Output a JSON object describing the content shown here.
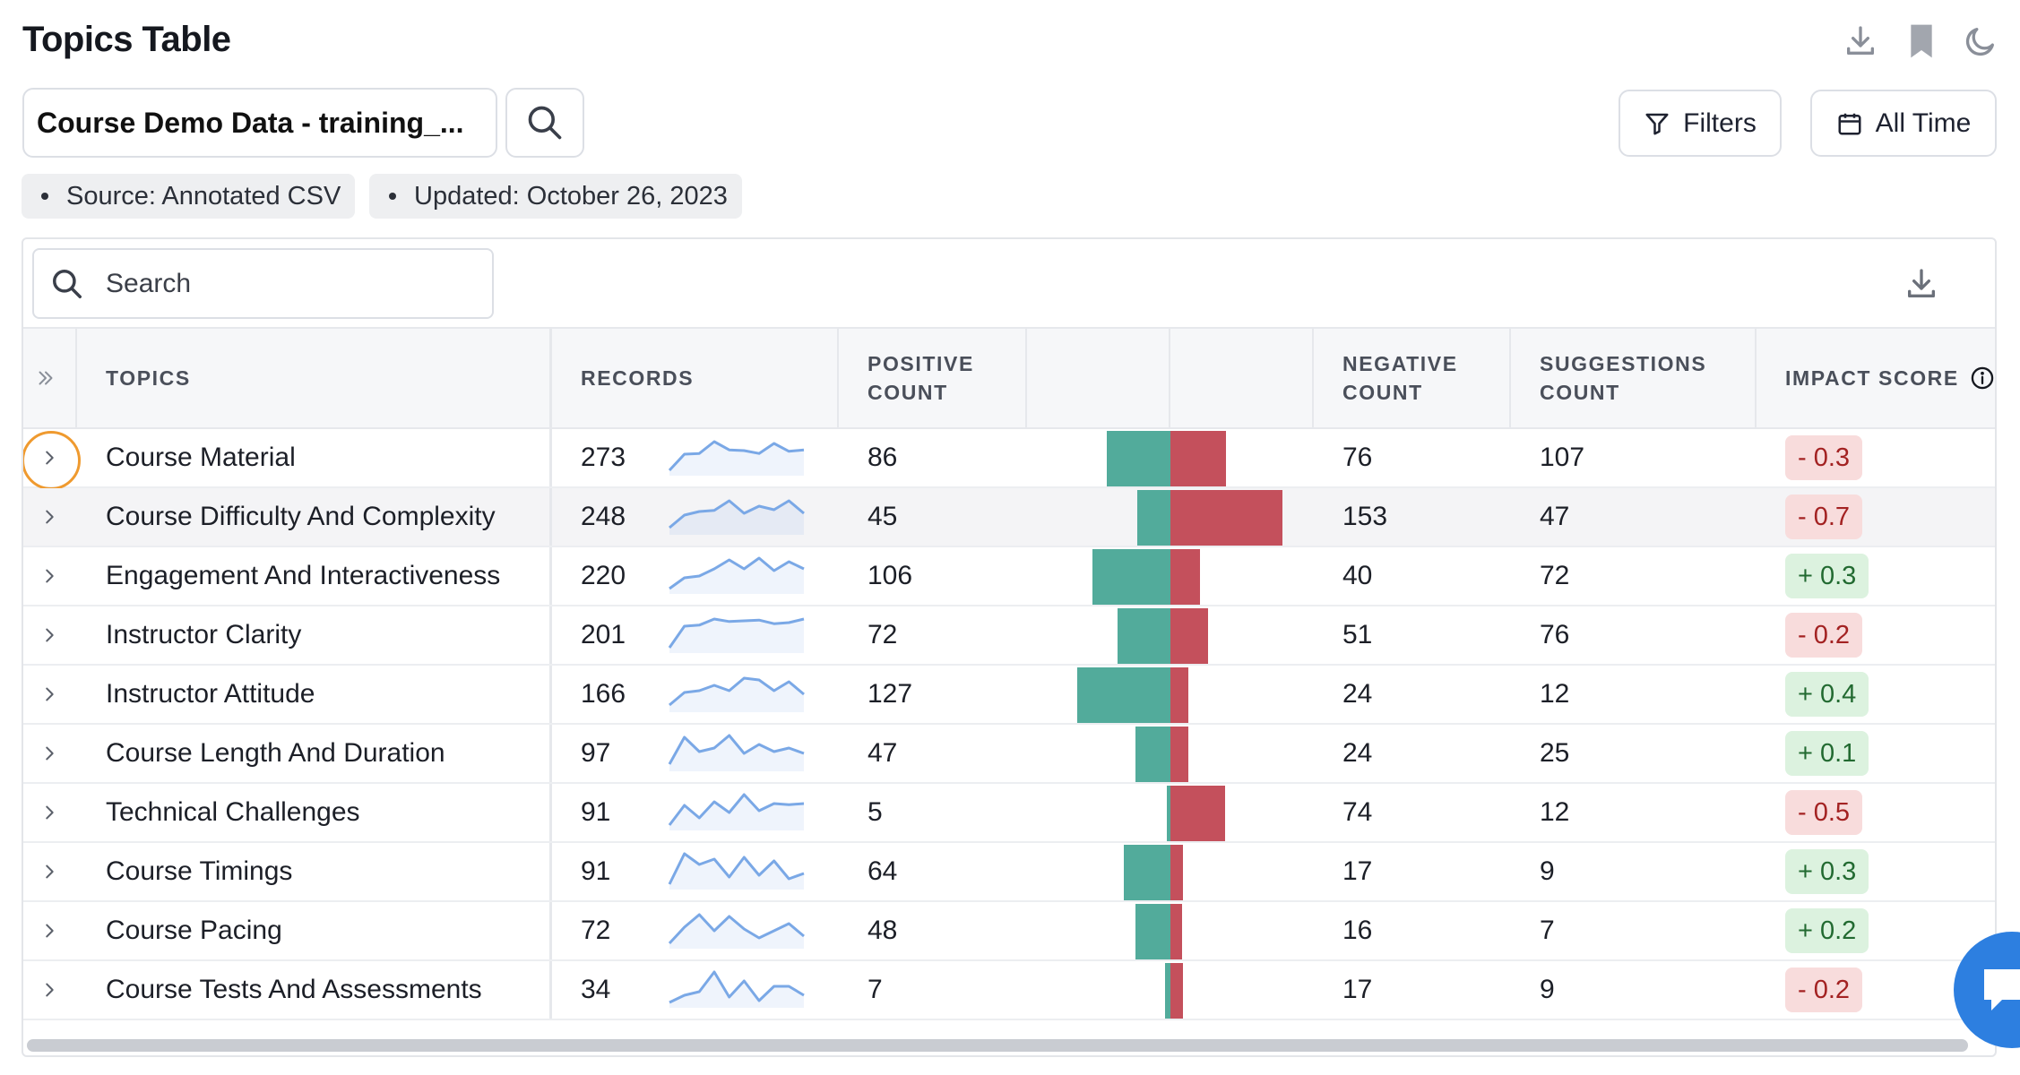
{
  "header": {
    "title": "Topics Table",
    "icons": [
      "download-icon",
      "bookmark-icon",
      "moon-icon"
    ]
  },
  "dataset": {
    "name": "Course Demo Data - training_...",
    "search_icon": "search-icon"
  },
  "actions": {
    "filters_label": "Filters",
    "date_label": "All Time"
  },
  "chips": {
    "source": "Source: Annotated CSV",
    "updated": "Updated: October 26, 2023"
  },
  "table": {
    "search_placeholder": "Search",
    "columns": {
      "topics": "TOPICS",
      "records": "RECORDS",
      "positive_1": "POSITIVE",
      "positive_2": "COUNT",
      "negative_1": "NEGATIVE",
      "negative_2": "COUNT",
      "suggestions_1": "SUGGESTIONS",
      "suggestions_2": "COUNT",
      "impact": "IMPACT SCORE"
    },
    "colors": {
      "positive": "#52ab9b",
      "negative": "#c4505c",
      "sparkline": "#7aa8e6",
      "focus_ring": "#ef9a2f"
    },
    "rows": [
      {
        "topic": "Course Material",
        "records": "273",
        "positive": "86",
        "negative": "76",
        "suggestions": "107",
        "impact": "- 0.3",
        "impact_sign": "neg",
        "trend": [
          0.15,
          0.6,
          0.62,
          0.95,
          0.72,
          0.7,
          0.62,
          0.9,
          0.68,
          0.72
        ]
      },
      {
        "topic": "Course Difficulty And Complexity",
        "records": "248",
        "positive": "45",
        "negative": "153",
        "suggestions": "47",
        "impact": "- 0.7",
        "impact_sign": "neg",
        "trend": [
          0.2,
          0.55,
          0.65,
          0.68,
          0.95,
          0.6,
          0.8,
          0.7,
          0.95,
          0.6
        ]
      },
      {
        "topic": "Engagement And Interactiveness",
        "records": "220",
        "positive": "106",
        "negative": "40",
        "suggestions": "72",
        "impact": "+ 0.3",
        "impact_sign": "pos",
        "trend": [
          0.15,
          0.45,
          0.5,
          0.7,
          0.95,
          0.7,
          1.0,
          0.65,
          0.9,
          0.7
        ]
      },
      {
        "topic": "Instructor Clarity",
        "records": "201",
        "positive": "72",
        "negative": "51",
        "suggestions": "76",
        "impact": "- 0.2",
        "impact_sign": "neg",
        "trend": [
          0.15,
          0.75,
          0.78,
          0.95,
          0.88,
          0.9,
          0.92,
          0.82,
          0.85,
          0.95
        ]
      },
      {
        "topic": "Instructor Attitude",
        "records": "166",
        "positive": "127",
        "negative": "24",
        "suggestions": "12",
        "impact": "+ 0.4",
        "impact_sign": "pos",
        "trend": [
          0.2,
          0.55,
          0.6,
          0.75,
          0.6,
          0.95,
          0.9,
          0.6,
          0.85,
          0.5
        ]
      },
      {
        "topic": "Course Length And Duration",
        "records": "97",
        "positive": "47",
        "negative": "24",
        "suggestions": "25",
        "impact": "+ 0.1",
        "impact_sign": "pos",
        "trend": [
          0.2,
          0.95,
          0.55,
          0.65,
          1.0,
          0.5,
          0.75,
          0.55,
          0.65,
          0.5
        ]
      },
      {
        "topic": "Technical Challenges",
        "records": "91",
        "positive": "5",
        "negative": "74",
        "suggestions": "12",
        "impact": "- 0.5",
        "impact_sign": "neg",
        "trend": [
          0.15,
          0.7,
          0.35,
          0.8,
          0.5,
          1.0,
          0.55,
          0.75,
          0.72,
          0.75
        ]
      },
      {
        "topic": "Course Timings",
        "records": "91",
        "positive": "64",
        "negative": "17",
        "suggestions": "9",
        "impact": "+ 0.3",
        "impact_sign": "pos",
        "trend": [
          0.15,
          1.0,
          0.7,
          0.85,
          0.35,
          0.9,
          0.4,
          0.8,
          0.3,
          0.45
        ]
      },
      {
        "topic": "Course Pacing",
        "records": "72",
        "positive": "48",
        "negative": "16",
        "suggestions": "7",
        "impact": "+ 0.2",
        "impact_sign": "pos",
        "trend": [
          0.15,
          0.6,
          0.95,
          0.5,
          0.9,
          0.55,
          0.3,
          0.5,
          0.7,
          0.35
        ]
      },
      {
        "topic": "Course Tests And Assessments",
        "records": "34",
        "positive": "7",
        "negative": "17",
        "suggestions": "9",
        "impact": "- 0.2",
        "impact_sign": "neg",
        "trend": [
          0.15,
          0.35,
          0.45,
          1.0,
          0.3,
          0.75,
          0.2,
          0.6,
          0.6,
          0.35
        ]
      }
    ]
  }
}
